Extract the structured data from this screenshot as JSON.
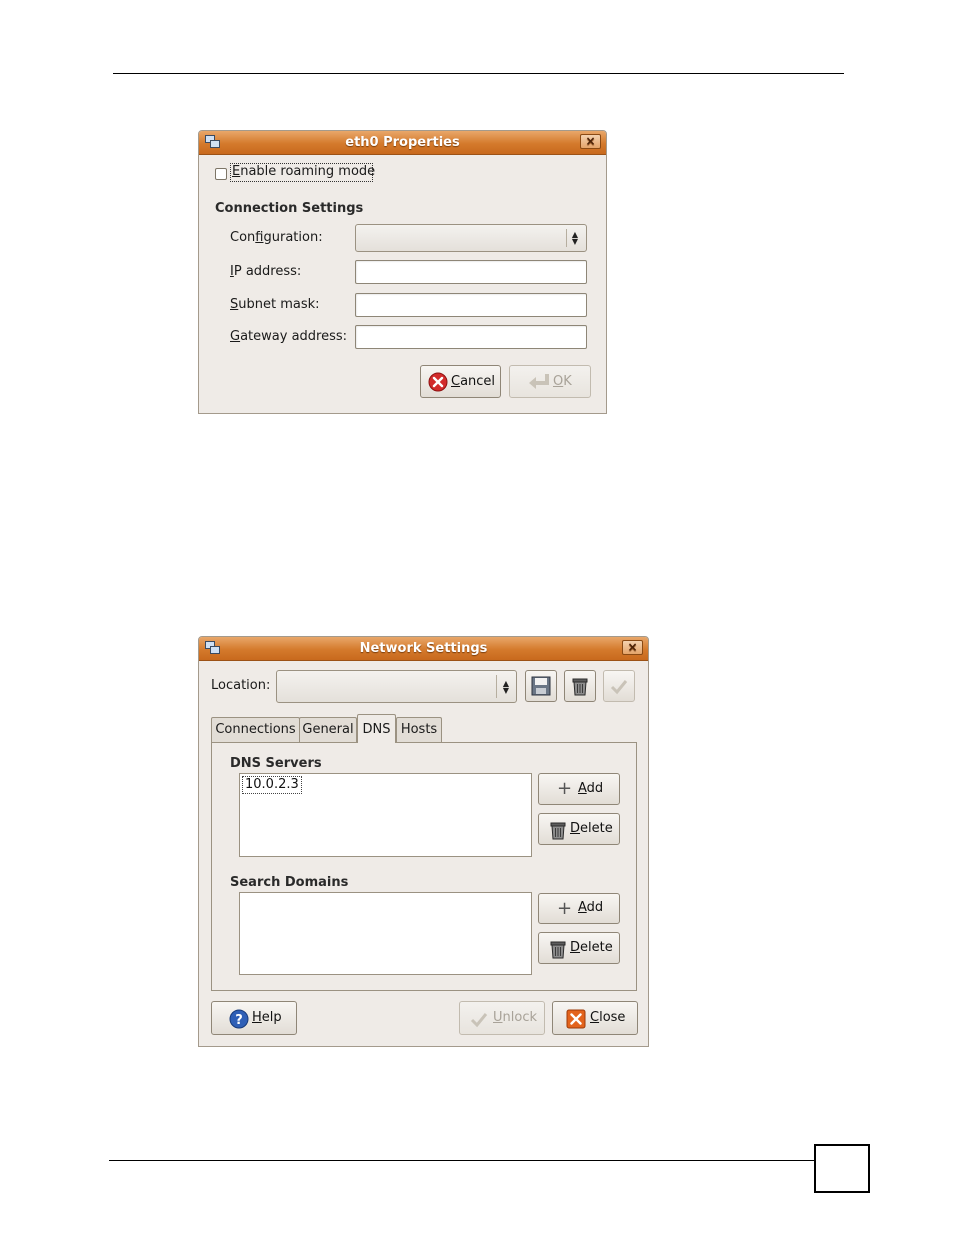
{
  "dialog1": {
    "title": "eth0 Properties",
    "close_glyph": "×",
    "roaming_checkbox": {
      "label_u": "E",
      "label_rest": "nable roaming mode",
      "checked": false
    },
    "section_title": "Connection Settings",
    "configuration": {
      "pre": "Con",
      "u": "f",
      "post": "iguration:",
      "value": ""
    },
    "ip": {
      "u": "I",
      "post": "P address:",
      "value": ""
    },
    "subnet": {
      "u": "S",
      "post": "ubnet mask:",
      "value": ""
    },
    "gateway": {
      "u": "G",
      "post": "ateway address:",
      "value": ""
    },
    "cancel": {
      "u": "C",
      "post": "ancel",
      "icon": "cancel-icon"
    },
    "ok": {
      "u": "O",
      "post": "K",
      "icon": "return-arrow-icon",
      "disabled": true
    }
  },
  "dialog2": {
    "title": "Network Settings",
    "close_glyph": "×",
    "location_label": "Location:",
    "location_value": "",
    "tabs": [
      {
        "label": "Connections",
        "active": false
      },
      {
        "label": "General",
        "active": false
      },
      {
        "label": "DNS",
        "active": true
      },
      {
        "label": "Hosts",
        "active": false
      }
    ],
    "dns_servers": {
      "title": "DNS Servers",
      "items": [
        "10.0.2.3"
      ],
      "add": {
        "u": "A",
        "post": "dd"
      },
      "delete": {
        "u": "D",
        "post": "elete"
      }
    },
    "search_domains": {
      "title": "Search Domains",
      "items": [],
      "add": {
        "u": "A",
        "post": "dd"
      },
      "delete": {
        "u": "D",
        "post": "elete"
      }
    },
    "help": {
      "u": "H",
      "post": "elp"
    },
    "unlock": {
      "u": "U",
      "post": "nlock",
      "disabled": true
    },
    "close": {
      "u": "C",
      "post": "lose"
    }
  },
  "colors": {
    "titlebar": "#d47a2c",
    "window_bg": "#efebe7",
    "border": "#9b9282"
  }
}
